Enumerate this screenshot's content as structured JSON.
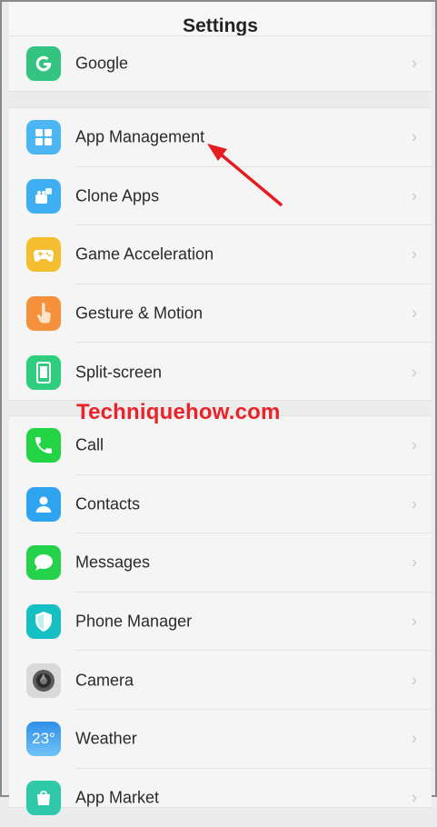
{
  "header": {
    "title": "Settings"
  },
  "group_top": {
    "items": [
      {
        "label": "Google",
        "icon": "google-icon",
        "color": "#33c481"
      }
    ]
  },
  "group_system": {
    "items": [
      {
        "label": "App Management",
        "icon": "app-grid-icon",
        "color": "#4cb6f5"
      },
      {
        "label": "Clone Apps",
        "icon": "clone-apps-icon",
        "color": "#3eaff1"
      },
      {
        "label": "Game Acceleration",
        "icon": "gamepad-icon",
        "color": "#f5be30"
      },
      {
        "label": "Gesture & Motion",
        "icon": "hand-pointer-icon",
        "color": "#f5913a"
      },
      {
        "label": "Split-screen",
        "icon": "split-screen-icon",
        "color": "#2fce7e"
      }
    ]
  },
  "group_apps": {
    "items": [
      {
        "label": "Call",
        "icon": "phone-icon",
        "color": "#23d445"
      },
      {
        "label": "Contacts",
        "icon": "contact-person-icon",
        "color": "#2ea4f1"
      },
      {
        "label": "Messages",
        "icon": "message-bubble-icon",
        "color": "#24d24b"
      },
      {
        "label": "Phone Manager",
        "icon": "shield-icon",
        "color": "#14c0c4"
      },
      {
        "label": "Camera",
        "icon": "camera-lens-icon",
        "color": "#d9d9d9"
      },
      {
        "label": "Weather",
        "icon": "weather-icon",
        "color": "#2f8fe8"
      },
      {
        "label": "App Market",
        "icon": "market-icon",
        "color": "#2fc8a8"
      }
    ]
  },
  "weather_icon_text": "23°",
  "watermark": "Techniquehow.com",
  "annotation_arrow_color": "#e51d22",
  "chevron": "›"
}
